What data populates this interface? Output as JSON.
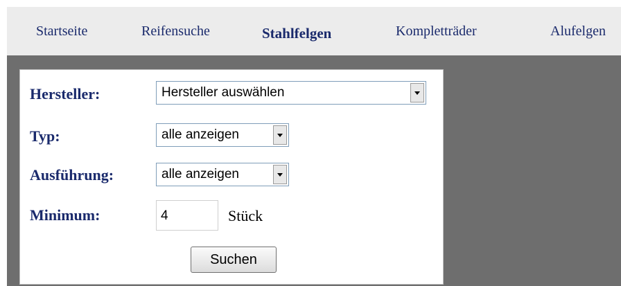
{
  "nav": {
    "items": [
      {
        "label": "Startseite"
      },
      {
        "label": "Reifensuche"
      },
      {
        "label": "Stahlfelgen"
      },
      {
        "label": "Kompletträder"
      },
      {
        "label": "Alufelgen"
      }
    ],
    "active": "Stahlfelgen"
  },
  "form": {
    "hersteller": {
      "label": "Hersteller:",
      "value": "Hersteller auswählen"
    },
    "typ": {
      "label": "Typ:",
      "value": "alle anzeigen"
    },
    "ausfuehrung": {
      "label": "Ausführung:",
      "value": "alle anzeigen"
    },
    "minimum": {
      "label": "Minimum:",
      "value": "4",
      "unit": "Stück"
    },
    "submit_label": "Suchen"
  },
  "colors": {
    "nav_text": "#1a2a6c",
    "nav_bar": "#ececec",
    "content_bg": "#6e6e6e",
    "panel_bg": "#ffffff"
  },
  "icons": {
    "dropdown": "chevron-down-icon"
  }
}
